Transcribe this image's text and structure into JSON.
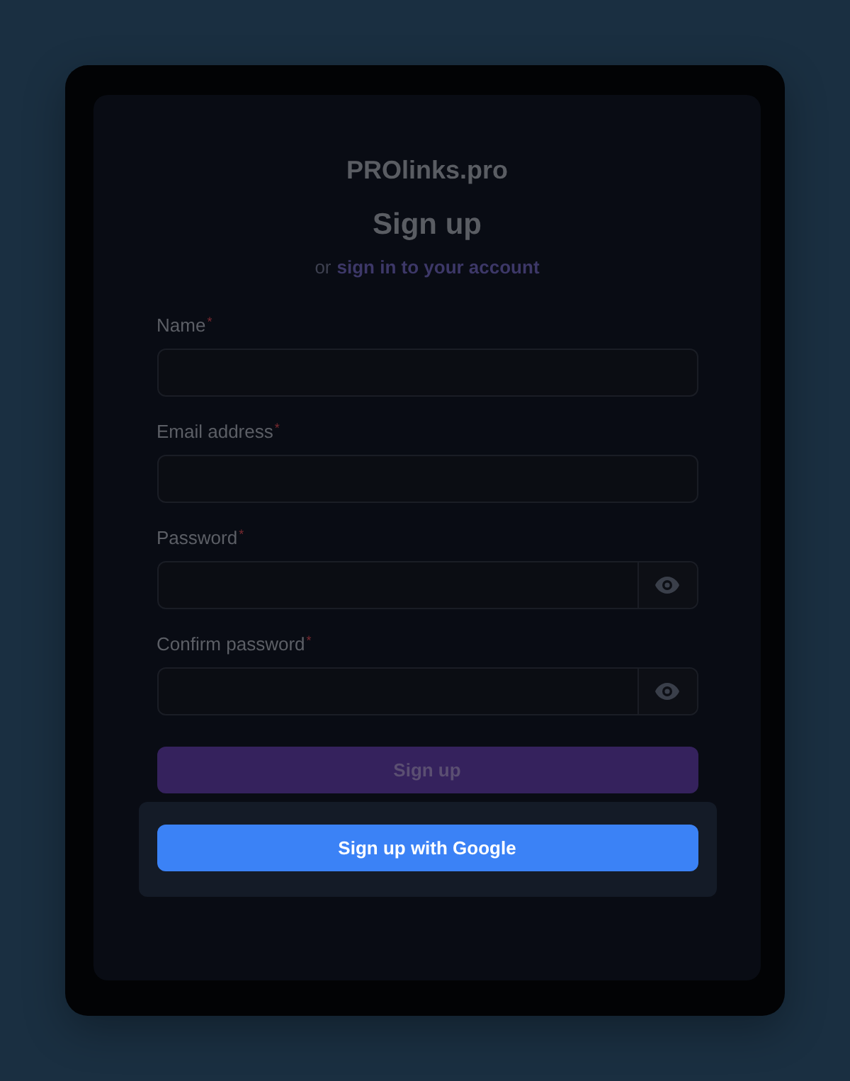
{
  "brand": "PROlinks.pro",
  "heading": "Sign up",
  "subtitle": {
    "prefix": "or",
    "link": "sign in to your account"
  },
  "fields": [
    {
      "kind": "text",
      "label": "Name",
      "marker": "*"
    },
    {
      "kind": "text",
      "label": "Email address",
      "marker": "*"
    },
    {
      "kind": "password",
      "label": "Password",
      "marker": "*"
    },
    {
      "kind": "password",
      "label": "Confirm password",
      "marker": "*"
    }
  ],
  "submit": {
    "label": "Sign up",
    "disabled": true
  },
  "google_button": {
    "label": "Sign up with Google"
  }
}
